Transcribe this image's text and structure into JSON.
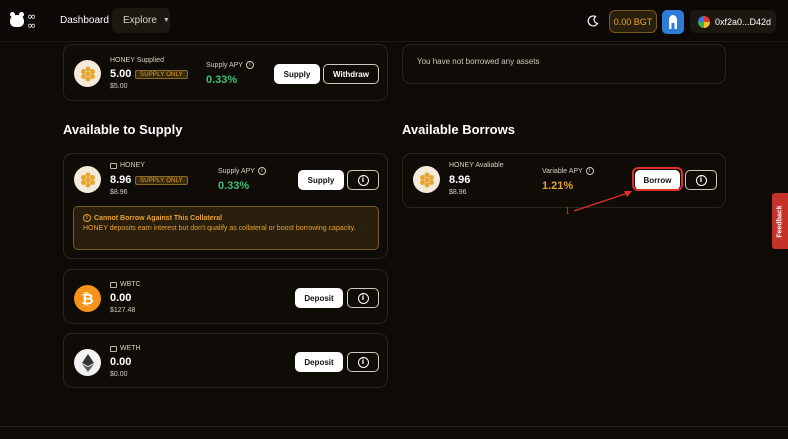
{
  "nav": {
    "dashboard_label": "Dashboard",
    "explore_label": "Explore",
    "bgt_balance": "0.00 BGT",
    "wallet_address": "0xf2a0...D42d"
  },
  "supplied": {
    "label": "HONEY Supplied",
    "amount": "5.00",
    "badge": "SUPPLY ONLY",
    "usd": "$5.00",
    "apy_label": "Supply APY",
    "apy": "0.33%",
    "supply_btn": "Supply",
    "withdraw_btn": "Withdraw"
  },
  "borrowed": {
    "empty_text": "You have not borrowed any assets"
  },
  "available_supply": {
    "title": "Available to Supply",
    "honey": {
      "label": "HONEY",
      "amount": "8.96",
      "badge": "SUPPLY ONLY",
      "usd": "$8.96",
      "apy_label": "Supply APY",
      "apy": "0.33%",
      "btn": "Supply",
      "warning_title": "Cannot Borrow Against This Collateral",
      "warning_body": "HONEY deposits earn interest but don't qualify as collateral or boost borrowing capacity."
    },
    "wbtc": {
      "label": "WBTC",
      "amount": "0.00",
      "usd": "$127.48",
      "btn": "Deposit"
    },
    "weth": {
      "label": "WETH",
      "amount": "0.00",
      "usd": "$0.00",
      "btn": "Deposit"
    }
  },
  "available_borrows": {
    "title": "Available Borrows",
    "honey": {
      "label": "HONEY Avaliable",
      "amount": "8.96",
      "usd": "$8.96",
      "apy_label": "Variable APY",
      "apy": "1.21%",
      "btn": "Borrow"
    }
  },
  "annotation": {
    "number": "1"
  },
  "feedback_label": "Feedback",
  "colors": {
    "accent": "#e7a42e",
    "green": "#3fbf74",
    "annotation": "#e0302a",
    "background": "#0e0a06"
  }
}
